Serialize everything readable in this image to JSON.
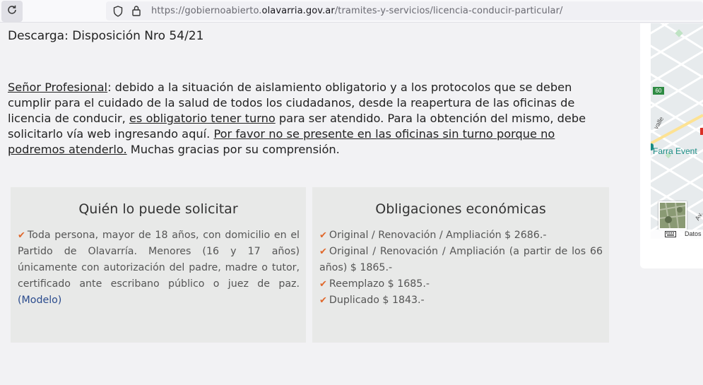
{
  "browser": {
    "url_prefix": "https://gobiernoabierto.",
    "url_domain": "olavarria.gov.ar",
    "url_path": "/tramites-y-servicios/licencia-conducir-particular/"
  },
  "download": {
    "label": "Descarga:",
    "link": "Disposición Nro 54/21"
  },
  "notice": {
    "lead": "Señor Profesional",
    "part1": ": debido a la situación de aislamiento obligatorio y a los protocolos que se deben cumplir para el cuidado de la salud de todos los ciudadanos, desde la reapertura de las oficinas de licencia de conducir, ",
    "emphasis1": "es obligatorio tener turno",
    "part2": " para ser atendido. Para la obtención del mismo, debe solicitarlo vía web ingresando aquí. ",
    "emphasis2": "Por favor no se presente en las oficinas sin turno porque no podremos atenderlo.",
    "part3": " Muchas gracias por su comprensión."
  },
  "who": {
    "title": "Quién lo puede solicitar",
    "text": "Toda persona, mayor de 18 años, con domicilio en el Partido de Olavarría. Menores (16 y 17 años) únicamente con autorización del padre, madre o tutor, certificado ante escribano público o juez de paz.",
    "link": "(Modelo)"
  },
  "fees": {
    "title": "Obligaciones económicas",
    "items": [
      "Original / Renovación / Ampliación $ 2686.-",
      "Original / Renovación / Ampliación (a partir de los 66 años) $ 1865.-",
      "Reemplazo $ 1685.-",
      "Duplicado $ 1843.-"
    ]
  },
  "map": {
    "place_label": "Farra Event",
    "route": "60",
    "street1": "valle",
    "street2": "Av.",
    "footer": "Datos"
  },
  "colors": {
    "check": "#e0682c",
    "link": "#2a4b8d",
    "card_bg": "#e8e9e8",
    "map_label": "#1a8c84"
  }
}
